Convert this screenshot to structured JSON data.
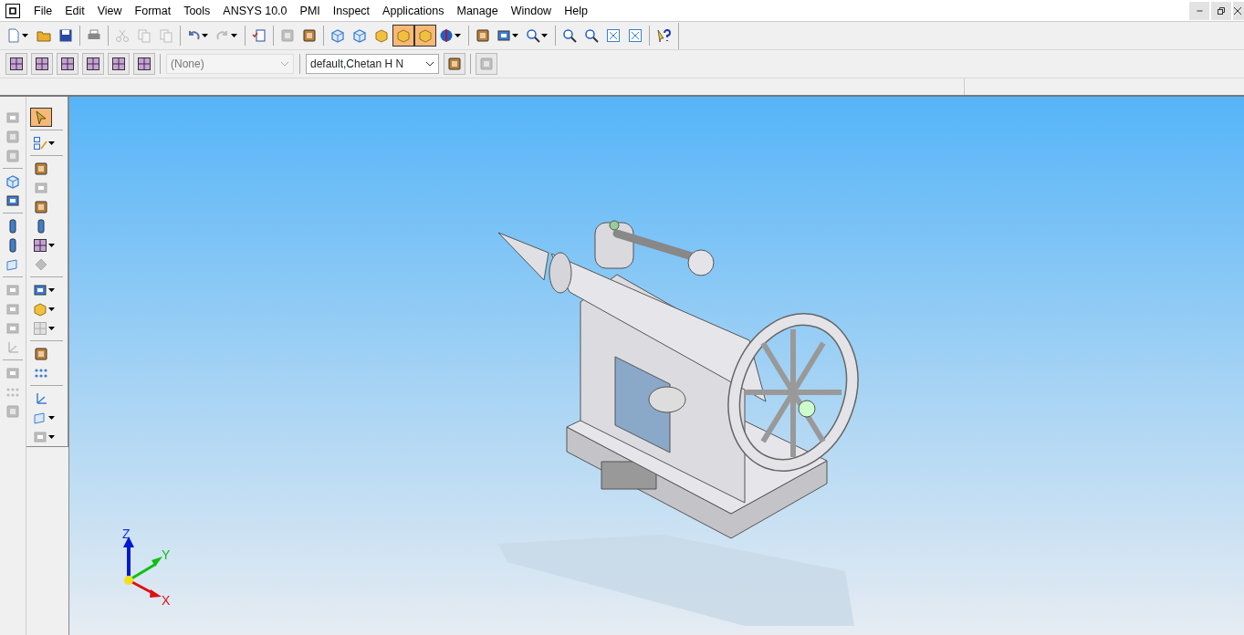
{
  "menu": [
    {
      "label": "File"
    },
    {
      "label": "Edit"
    },
    {
      "label": "View"
    },
    {
      "label": "Format"
    },
    {
      "label": "Tools"
    },
    {
      "label": "ANSYS 10.0"
    },
    {
      "label": "PMI"
    },
    {
      "label": "Inspect"
    },
    {
      "label": "Applications"
    },
    {
      "label": "Manage"
    },
    {
      "label": "Window"
    },
    {
      "label": "Help"
    }
  ],
  "toolbar_main": [
    {
      "kind": "button",
      "disabled": false,
      "selected": false,
      "dropdown": true
    },
    {
      "kind": "button",
      "disabled": false,
      "selected": false,
      "dropdown": false
    },
    {
      "kind": "button",
      "disabled": false,
      "selected": false,
      "dropdown": false
    },
    {
      "kind": "separator"
    },
    {
      "kind": "button",
      "disabled": false,
      "selected": false,
      "dropdown": false
    },
    {
      "kind": "separator"
    },
    {
      "kind": "button",
      "disabled": true,
      "selected": false,
      "dropdown": false
    },
    {
      "kind": "button",
      "disabled": true,
      "selected": false,
      "dropdown": false
    },
    {
      "kind": "button",
      "disabled": true,
      "selected": false,
      "dropdown": false
    },
    {
      "kind": "separator"
    },
    {
      "kind": "button",
      "disabled": false,
      "selected": false,
      "dropdown": true
    },
    {
      "kind": "button",
      "disabled": true,
      "selected": false,
      "dropdown": true
    },
    {
      "kind": "separator"
    },
    {
      "kind": "button",
      "disabled": false,
      "selected": false,
      "dropdown": false
    },
    {
      "kind": "separator"
    },
    {
      "kind": "button",
      "disabled": true,
      "selected": false,
      "dropdown": false
    },
    {
      "kind": "button",
      "disabled": false,
      "selected": false,
      "dropdown": false
    },
    {
      "kind": "separator"
    },
    {
      "kind": "button",
      "disabled": false,
      "selected": false,
      "dropdown": false
    },
    {
      "kind": "button",
      "disabled": false,
      "selected": false,
      "dropdown": false
    },
    {
      "kind": "button",
      "disabled": false,
      "selected": false,
      "dropdown": false
    },
    {
      "kind": "button",
      "disabled": false,
      "selected": true,
      "dropdown": false
    },
    {
      "kind": "button",
      "disabled": false,
      "selected": true,
      "dropdown": false
    },
    {
      "kind": "button",
      "disabled": false,
      "selected": false,
      "dropdown": true
    },
    {
      "kind": "separator"
    },
    {
      "kind": "button",
      "disabled": false,
      "selected": false,
      "dropdown": false
    },
    {
      "kind": "button",
      "disabled": false,
      "selected": false,
      "dropdown": true
    },
    {
      "kind": "button",
      "disabled": false,
      "selected": false,
      "dropdown": true
    },
    {
      "kind": "separator"
    },
    {
      "kind": "button",
      "disabled": false,
      "selected": false,
      "dropdown": false
    },
    {
      "kind": "button",
      "disabled": false,
      "selected": false,
      "dropdown": false
    },
    {
      "kind": "button",
      "disabled": false,
      "selected": false,
      "dropdown": false
    },
    {
      "kind": "button",
      "disabled": false,
      "selected": false,
      "dropdown": false
    },
    {
      "kind": "separator"
    },
    {
      "kind": "button",
      "disabled": false,
      "selected": false,
      "dropdown": false
    }
  ],
  "toolbar_selection": [
    {
      "kind": "button",
      "disabled": false
    },
    {
      "kind": "button",
      "disabled": false
    },
    {
      "kind": "button",
      "disabled": false
    },
    {
      "kind": "button",
      "disabled": false
    },
    {
      "kind": "button",
      "disabled": false
    },
    {
      "kind": "button",
      "disabled": false
    },
    {
      "kind": "separator"
    },
    {
      "kind": "combo",
      "value": "(None)",
      "disabled": true
    },
    {
      "kind": "separator"
    },
    {
      "kind": "combo",
      "value": "default,Chetan H N",
      "disabled": false
    },
    {
      "kind": "button",
      "disabled": false
    },
    {
      "kind": "separator"
    },
    {
      "kind": "button",
      "disabled": true
    }
  ],
  "side_toolbar_left": [
    {
      "kind": "button",
      "disabled": true
    },
    {
      "kind": "button",
      "disabled": true
    },
    {
      "kind": "button",
      "disabled": true
    },
    {
      "kind": "separator"
    },
    {
      "kind": "button",
      "disabled": false
    },
    {
      "kind": "button",
      "disabled": false
    },
    {
      "kind": "separator"
    },
    {
      "kind": "button",
      "disabled": false
    },
    {
      "kind": "button",
      "disabled": false
    },
    {
      "kind": "button",
      "disabled": false
    },
    {
      "kind": "separator"
    },
    {
      "kind": "button",
      "disabled": true
    },
    {
      "kind": "button",
      "disabled": true
    },
    {
      "kind": "button",
      "disabled": true
    },
    {
      "kind": "button",
      "disabled": true
    },
    {
      "kind": "separator"
    },
    {
      "kind": "button",
      "disabled": true
    },
    {
      "kind": "button",
      "disabled": true
    },
    {
      "kind": "button",
      "disabled": true
    }
  ],
  "side_toolbar_right": [
    {
      "kind": "button",
      "disabled": false,
      "selected": true,
      "dropdown": false
    },
    {
      "kind": "separator"
    },
    {
      "kind": "button",
      "disabled": false,
      "selected": false,
      "dropdown": true
    },
    {
      "kind": "separator"
    },
    {
      "kind": "button",
      "disabled": false,
      "selected": false,
      "dropdown": false
    },
    {
      "kind": "button",
      "disabled": true,
      "selected": false,
      "dropdown": false
    },
    {
      "kind": "button",
      "disabled": false,
      "selected": false,
      "dropdown": false
    },
    {
      "kind": "button",
      "disabled": false,
      "selected": false,
      "dropdown": false
    },
    {
      "kind": "button",
      "disabled": false,
      "selected": false,
      "dropdown": true
    },
    {
      "kind": "button",
      "disabled": true,
      "selected": false,
      "dropdown": false
    },
    {
      "kind": "separator"
    },
    {
      "kind": "button",
      "disabled": false,
      "selected": false,
      "dropdown": true
    },
    {
      "kind": "button",
      "disabled": false,
      "selected": false,
      "dropdown": true
    },
    {
      "kind": "button",
      "disabled": true,
      "selected": false,
      "dropdown": true
    },
    {
      "kind": "separator"
    },
    {
      "kind": "button",
      "disabled": false,
      "selected": false,
      "dropdown": false
    },
    {
      "kind": "button",
      "disabled": false,
      "selected": false,
      "dropdown": false
    },
    {
      "kind": "separator"
    },
    {
      "kind": "button",
      "disabled": false,
      "selected": false,
      "dropdown": false
    },
    {
      "kind": "button",
      "disabled": false,
      "selected": false,
      "dropdown": true
    },
    {
      "kind": "button",
      "disabled": true,
      "selected": false,
      "dropdown": true
    }
  ],
  "triad": {
    "axes": [
      {
        "label": "Z"
      },
      {
        "label": "Y"
      },
      {
        "label": "X"
      }
    ]
  }
}
